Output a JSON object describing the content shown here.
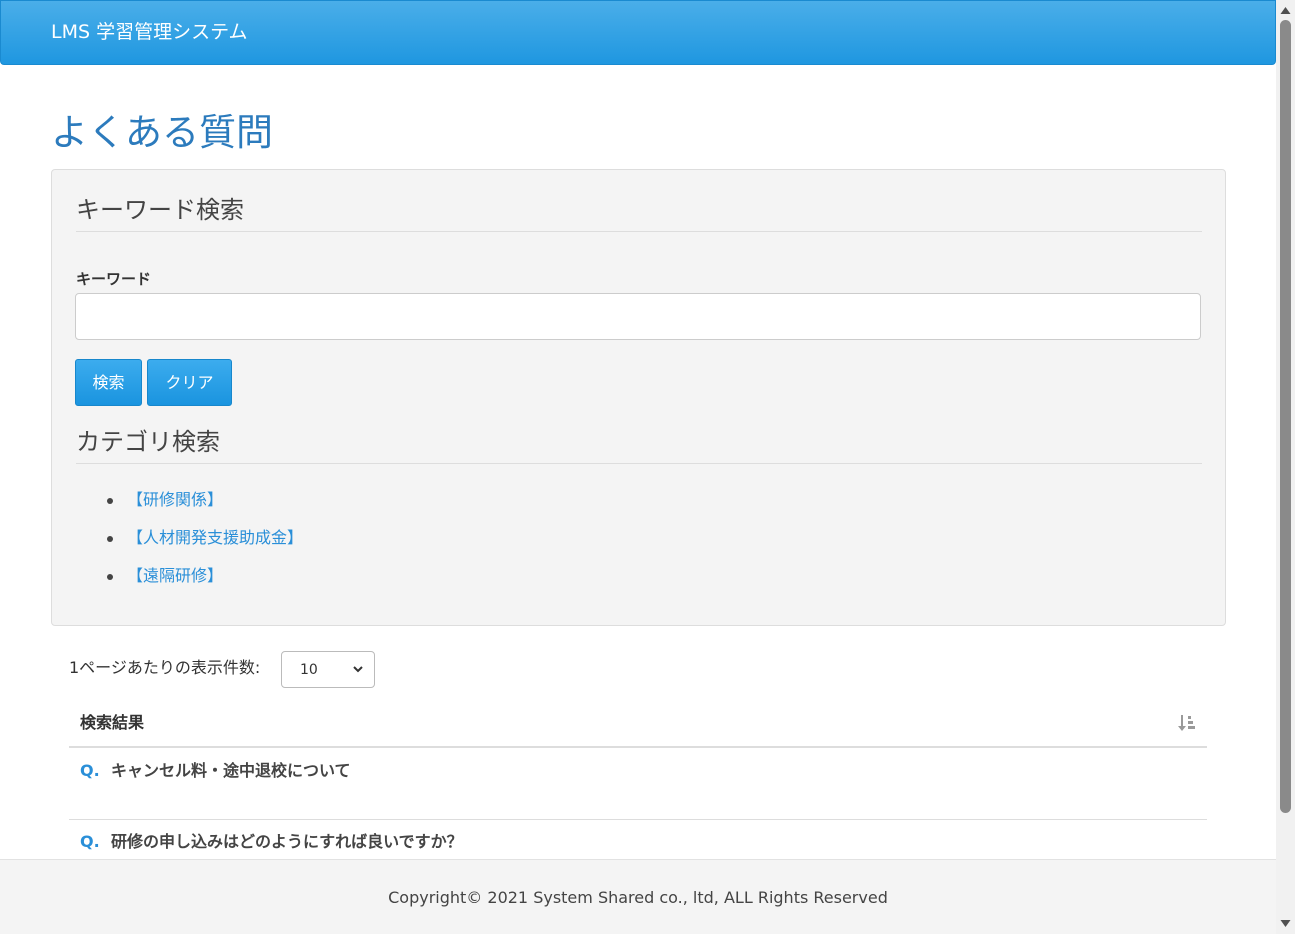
{
  "header": {
    "brand": "LMS 学習管理システム"
  },
  "page": {
    "title": "よくある質問"
  },
  "keyword_search": {
    "title": "キーワード検索",
    "field_label": "キーワード",
    "value": "",
    "placeholder": "",
    "search_button": "検索",
    "clear_button": "クリア"
  },
  "category_search": {
    "title": "カテゴリ検索",
    "items": [
      {
        "label": "【研修関係】"
      },
      {
        "label": "【人材開発支援助成金】"
      },
      {
        "label": "【遠隔研修】"
      }
    ]
  },
  "results": {
    "per_page_label": "1ページあたりの表示件数:",
    "per_page_value": "10",
    "header_label": "検索結果",
    "q_marker": "Q.",
    "items": [
      {
        "question": "キャンセル料・途中退校について"
      },
      {
        "question": "研修の申し込みはどのようにすれば良いですか？"
      }
    ]
  },
  "footer": {
    "copyright": "Copyright© 2021 System Shared co., ltd, ALL Rights Reserved"
  },
  "colors": {
    "brand_blue": "#1f97e0",
    "title_blue": "#2c7bbd",
    "link_blue": "#2a8fd8"
  }
}
